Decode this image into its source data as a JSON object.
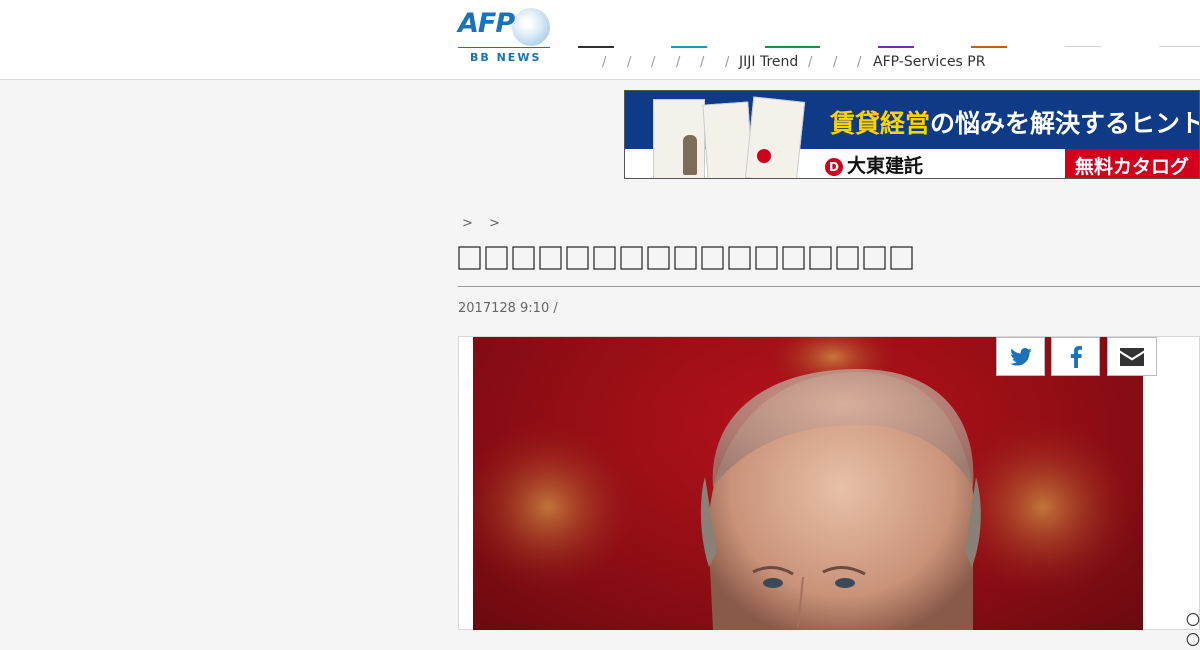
{
  "header": {
    "logo": {
      "brand": "AFP",
      "sub": "BB NEWS"
    },
    "nav": {
      "separator": "/",
      "items": [
        "JIJI Trend",
        "AFP-Services PR"
      ]
    },
    "colors": {
      "nav_bars": [
        "#333333",
        "#1a9bb5",
        "#2e8b3e",
        "#7a2a9c",
        "#b5651d",
        "#cccccc",
        "#cccccc"
      ],
      "brand": "#1a73b8"
    }
  },
  "ad": {
    "headline_highlight": "賃貸経営",
    "headline_rest": "の悩みを解決するヒント",
    "company": "大東建託",
    "company_mark": "D",
    "cta": "無料カタログ"
  },
  "article": {
    "breadcrumb": "> >",
    "title": "",
    "dateline": "2017128 9:10 /"
  },
  "share": {
    "icons": [
      "twitter-icon",
      "facebook-icon",
      "email-icon"
    ]
  },
  "misc": {
    "corner_glyph": "〇〇"
  }
}
